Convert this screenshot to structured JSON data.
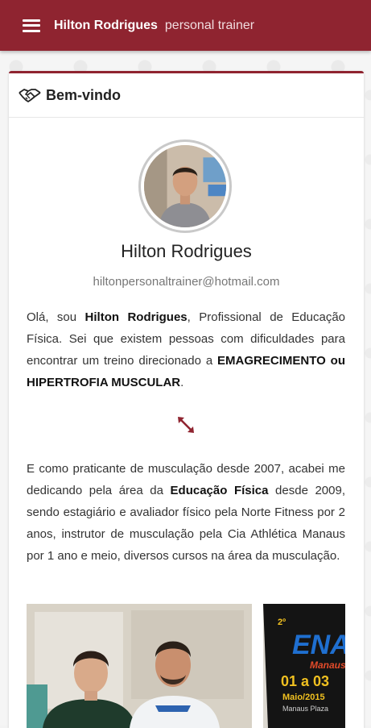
{
  "appbar": {
    "title": "Hilton Rodrigues",
    "subtitle": "personal trainer",
    "menu_icon": "hamburger-menu-icon",
    "color": "#8f2430"
  },
  "card": {
    "title": "Bem-vindo",
    "title_icon": "handshake-icon"
  },
  "profile": {
    "name": "Hilton Rodrigues",
    "email": "hiltonpersonaltrainer@hotmail.com"
  },
  "intro": {
    "part1": "Olá, sou ",
    "name_bold": "Hilton Rodrigues",
    "part2": ", Profissional de Educação Física. Sei que existem pessoas com dificuldades para encontrar um treino direcionado a ",
    "goal_bold": "EMAGRECIMENTO ou HIPERTROFIA MUSCULAR",
    "part3": "."
  },
  "expand_icon": "expand-arrows-icon",
  "career": {
    "part1": "E como praticante de musculação desde 2007, acabei me dedicando pela área da ",
    "field_bold": "Educação Física",
    "part2": " desde 2009, sendo estagiário e avaliador físico pela Norte Fitness por 2 anos, instrutor de musculação pela Cia Athlética Manaus por 1 ano e meio, diversos cursos na área da musculação."
  },
  "poster": {
    "line1": "ENAF",
    "line2": "Manaus",
    "dates": "01 a 03",
    "month": "Maio/2015",
    "venue": "Manaus Plaza"
  }
}
